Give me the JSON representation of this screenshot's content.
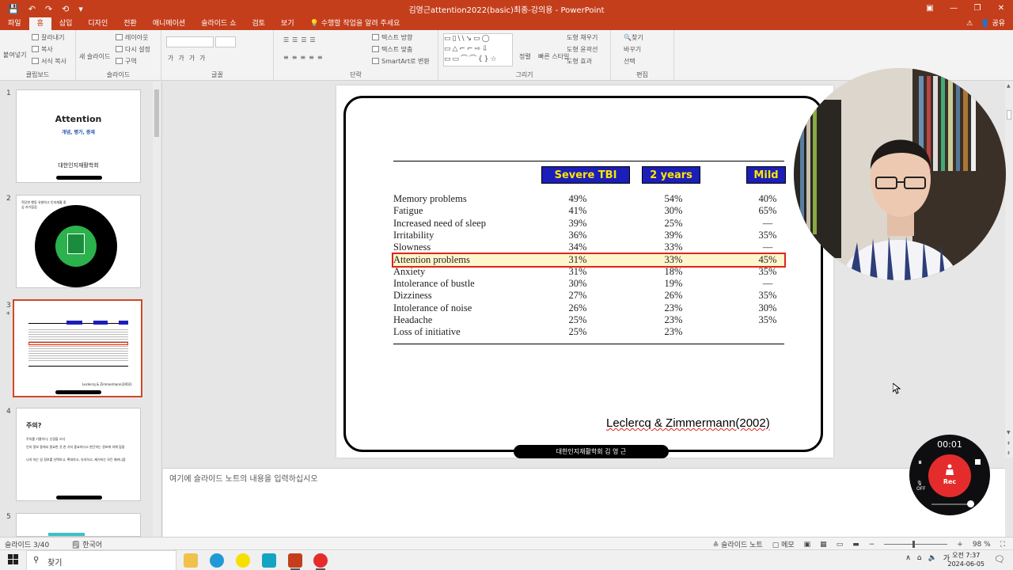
{
  "window": {
    "title": "김영근attention2022(basic)최종-강의용 - PowerPoint",
    "quick_access": [
      "💾",
      "↶",
      "↷",
      "⟲",
      "▾"
    ]
  },
  "ribbon_tabs": [
    "파일",
    "홈",
    "삽입",
    "디자인",
    "전환",
    "애니메이션",
    "슬라이드 쇼",
    "검토",
    "보기"
  ],
  "active_tab": "홈",
  "tell_me": "수행할 작업을 알려 주세요",
  "share_label": "공유",
  "ribbon": {
    "clipboard": {
      "paste": "붙여넣기",
      "cut": "잘라내기",
      "copy": "복사",
      "format_painter": "서식 복사",
      "label": "클립보드"
    },
    "slides": {
      "new_slide": "새 슬라이드",
      "layout": "레이아웃",
      "reset": "다시 설정",
      "section": "구역",
      "label": "슬라이드"
    },
    "font": {
      "label": "글꼴"
    },
    "paragraph": {
      "text_direction": "텍스트 방향",
      "align_text": "텍스트 맞춤",
      "smartart": "SmartArt로 변환",
      "label": "단락"
    },
    "drawing": {
      "arrange": "정렬",
      "quick_styles": "빠른 스타일",
      "fill": "도형 채우기",
      "outline": "도형 윤곽선",
      "effects": "도형 효과",
      "label": "그리기"
    },
    "editing": {
      "find": "찾기",
      "replace": "바꾸기",
      "select": "선택",
      "label": "편집"
    }
  },
  "thumbnails": [
    {
      "num": "1",
      "title": "Attention",
      "subtitle": "개념, 평가, 중재",
      "org": "대한인지재활학회"
    },
    {
      "num": "2",
      "caption": "적당한 행동 유발하고 인지재활 중심 자가점검"
    },
    {
      "num": "3",
      "star": "*",
      "caption": "Leclercq & Zimmermann(2002)"
    },
    {
      "num": "4",
      "title": "주의?",
      "bullets": [
        "주의를 기울이다, 신경을 쓰다",
        "인지 정보 중에서 중요한 것 한 가지 중요하다고 판단하는 정보에 의해 집중",
        "나의 하는 일 정보를 선택하고, 확대하고, 유지하고, 제거하는 모든 메커니즘"
      ]
    },
    {
      "num": "5"
    }
  ],
  "slide": {
    "headers": [
      "Severe TBI",
      "2 years",
      "Mild"
    ],
    "rows": [
      {
        "label": "Memory problems",
        "v1": "49%",
        "v2": "54%",
        "v3": "40%"
      },
      {
        "label": "Fatigue",
        "v1": "41%",
        "v2": "30%",
        "v3": "65%"
      },
      {
        "label": "Increased need of sleep",
        "v1": "39%",
        "v2": "25%",
        "v3": "—"
      },
      {
        "label": "Irritability",
        "v1": "36%",
        "v2": "39%",
        "v3": "35%"
      },
      {
        "label": "Slowness",
        "v1": "34%",
        "v2": "33%",
        "v3": "—"
      },
      {
        "label": "Attention problems",
        "v1": "31%",
        "v2": "33%",
        "v3": "45%"
      },
      {
        "label": "Anxiety",
        "v1": "31%",
        "v2": "18%",
        "v3": "35%"
      },
      {
        "label": "Intolerance of bustle",
        "v1": "30%",
        "v2": "19%",
        "v3": "—"
      },
      {
        "label": "Dizziness",
        "v1": "27%",
        "v2": "26%",
        "v3": "35%"
      },
      {
        "label": "Intolerance of noise",
        "v1": "26%",
        "v2": "23%",
        "v3": "30%"
      },
      {
        "label": "Headache",
        "v1": "25%",
        "v2": "23%",
        "v3": "35%"
      },
      {
        "label": "Loss of initiative",
        "v1": "25%",
        "v2": "23%",
        "v3": ""
      }
    ],
    "highlighted_row": "Attention problems",
    "citation": "Leclercq & Zimmermann(2002)",
    "footer": "대한인지재활학회  김 영 근"
  },
  "notes_placeholder": "여기에 슬라이드 노트의 내용을 입력하십시오",
  "status": {
    "slide_counter": "슬라이드 3/40",
    "language": "한국어",
    "notes_btn": "슬라이드 노트",
    "comments_btn": "메모",
    "zoom": "98 %"
  },
  "taskbar": {
    "search": "찾기",
    "time": "오전 7:37",
    "date": "2024-06-05",
    "ime": "가"
  },
  "recorder": {
    "elapsed": "00:01",
    "rec_label": "Rec",
    "off_label": "OFF"
  },
  "colors": {
    "accent": "#c43e1c",
    "header_fill": "#1b1eb8",
    "header_text": "#ffe600",
    "highlight_border": "#e2231a",
    "highlight_fill": "#fff6cc"
  }
}
